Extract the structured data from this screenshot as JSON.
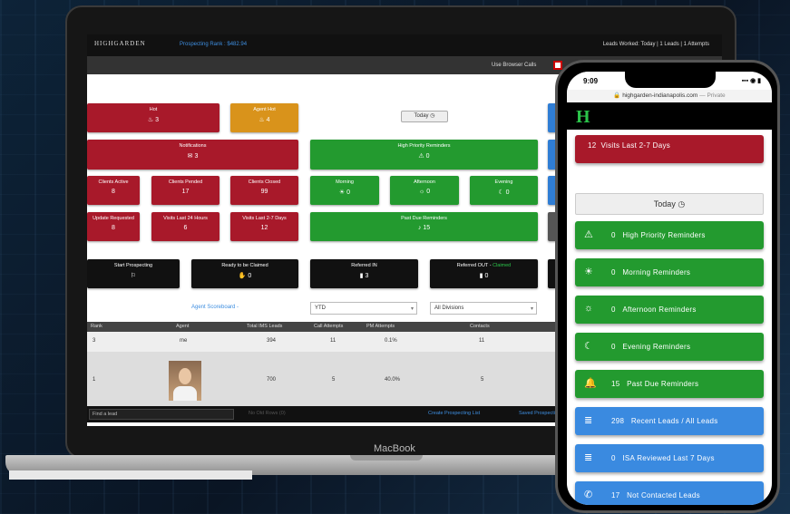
{
  "laptop": {
    "app": {
      "brand": "HIGHGARDEN",
      "prospecting_rank": "Prospecting Rank : $482.94",
      "leads_worked": "Leads Worked: Today | 1 Leads | 1 Attempts",
      "browser_calls_label": "Use Browser Calls"
    },
    "dashboard": {
      "hot": {
        "label": "Hot",
        "count": "3"
      },
      "agent_hot": {
        "label": "Agent Hot",
        "count": "4"
      },
      "today_button": "Today",
      "notifications": {
        "label": "Notifications",
        "count": "3"
      },
      "high_priority": {
        "label": "High Priority Reminders",
        "count": "0"
      },
      "clients_active": {
        "label": "Clients Active",
        "count": "8"
      },
      "clients_pended": {
        "label": "Clients Pended",
        "count": "17"
      },
      "clients_closed": {
        "label": "Clients Closed",
        "count": "99"
      },
      "morning": {
        "label": "Morning",
        "count": "0"
      },
      "afternoon": {
        "label": "Afternoon",
        "count": "0"
      },
      "evening": {
        "label": "Evening",
        "count": "0"
      },
      "update_requested": {
        "label": "Update Requested",
        "count": "8"
      },
      "visits_24": {
        "label": "Visits Last 24 Hours",
        "count": "6"
      },
      "visits_2_7": {
        "label": "Visits Last 2-7 Days",
        "count": "12"
      },
      "past_due": {
        "label": "Past Due Reminders",
        "count": "15"
      },
      "start_prospecting": {
        "label": "Start Prospecting"
      },
      "ready_claimed": {
        "label": "Ready to be Claimed",
        "count": "0"
      },
      "referred_in": {
        "label": "Referred IN",
        "count": "3"
      },
      "referred_out": {
        "label": "Referred OUT -",
        "status": "Claimed",
        "count": "0"
      }
    },
    "scoreboard": {
      "link": "Agent Scoreboard -",
      "period": "YTD",
      "division": "All Divisions",
      "headers": [
        "Rank",
        "Agent",
        "Total IMS Leads",
        "Call Attempts",
        "PM Attempts",
        "Contacts"
      ],
      "rows": [
        {
          "rank": "3",
          "agent": "me",
          "total": "394",
          "calls": "11",
          "pm": "0.1%",
          "contacts": "11"
        },
        {
          "rank": "1",
          "agent": "",
          "total": "700",
          "calls": "5",
          "pm": "40.0%",
          "contacts": "5"
        }
      ]
    },
    "footer": {
      "find_placeholder": "Find a lead",
      "no_rows": "No Old Rows (0)",
      "create_list": "Create Prospecting List",
      "saved_lists": "Saved Prospecting"
    },
    "model": "MacBook"
  },
  "phone": {
    "time": "9:09",
    "status_icons": "▪▪▪ ◉ ▮",
    "url": "highgarden-indianapolis.com",
    "private_label": "— Private",
    "logo": "H",
    "visits": {
      "count": "12",
      "label": "Visits Last 2-7 Days"
    },
    "today_button": "Today",
    "cards": [
      {
        "icon": "warning-icon",
        "glyph": "⚠",
        "count": "0",
        "label": "High Priority Reminders",
        "color": "green"
      },
      {
        "icon": "sunrise-icon",
        "glyph": "☀",
        "count": "0",
        "label": "Morning Reminders",
        "color": "green"
      },
      {
        "icon": "sun-icon",
        "glyph": "☼",
        "count": "0",
        "label": "Afternoon Reminders",
        "color": "green"
      },
      {
        "icon": "moon-icon",
        "glyph": "☾",
        "count": "0",
        "label": "Evening Reminders",
        "color": "green"
      },
      {
        "icon": "bell-icon",
        "glyph": "🔔",
        "count": "15",
        "label": "Past Due Reminders",
        "color": "green"
      },
      {
        "icon": "list-icon",
        "glyph": "≣",
        "count": "298",
        "label": "Recent Leads / All Leads",
        "color": "blue"
      },
      {
        "icon": "list-icon",
        "glyph": "≣",
        "count": "0",
        "label": "ISA Reviewed Last 7 Days",
        "color": "blue"
      },
      {
        "icon": "phone-icon",
        "glyph": "✆",
        "count": "17",
        "label": "Not Contacted Leads",
        "color": "blue"
      }
    ]
  },
  "colors": {
    "red": "#a8192a",
    "orange": "#d9931b",
    "green": "#239a2f",
    "blue": "#2f7dd4",
    "link": "#3e8ee0"
  }
}
